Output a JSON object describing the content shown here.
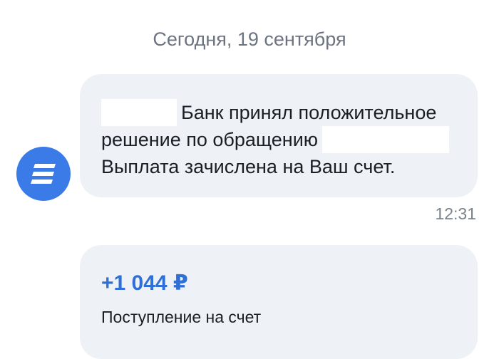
{
  "chat": {
    "date_separator": "Сегодня, 19 сентября",
    "message": {
      "line1": "Банк принял положительное",
      "line2": "решение по обращению",
      "line3": "Выплата зачислена на Ваш счет.",
      "time": "12:31"
    },
    "transaction": {
      "amount": "+1 044 ₽",
      "description": "Поступление на счет"
    }
  },
  "colors": {
    "accent": "#3a7be8",
    "amount": "#2f6fd8",
    "bubble": "#eef1f5",
    "muted_text": "#6b7480"
  },
  "icons": {
    "avatar": "bank-logo-icon"
  }
}
